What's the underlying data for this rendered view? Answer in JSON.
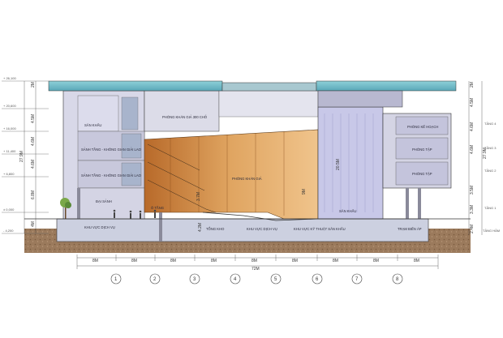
{
  "levels_left": [
    "+ 26,100",
    "+ 20,600",
    "+ 16,000",
    "+ 11,400",
    "+ 6,800",
    "± 0,000",
    "- 4,200"
  ],
  "heights_left": [
    "2M",
    "4.5M",
    "4.6M",
    "4.6M",
    "6.8M",
    "4M"
  ],
  "total_left": "27.9M",
  "heights_right": [
    "2M",
    "4.5M",
    "4.6M",
    "4.6M",
    "3.5M",
    "3.3M",
    "2.4M"
  ],
  "total_right": "27.9M",
  "floors_right": [
    "TẦNG 4",
    "TẦNG 3",
    "TẦNG 2",
    "TẦNG 1",
    "TẦNG HẦM"
  ],
  "rooms": {
    "san_khau_top": "SÂN KHẤU",
    "phong_khan_gia_300": "PHÒNG KHÁN GIẢ 300 CHỖ",
    "sanh_tang3": "SẢNH TẦNG - KHÔNG GIAN GIẢI LAO",
    "sanh_tang2": "SẢNH TẦNG - KHÔNG GIAN GIẢI LAO",
    "dai_sanh": "ĐẠI SẢNH",
    "khu_vuc_dich_vu": "KHU VỰC DỊCH VỤ",
    "o_tang": "Ô TẦNG",
    "phong_khan_gia": "PHÒNG KHÁN GIẢ",
    "tong_kho": "TỔNG KHO",
    "khu_vuc_dich_vu_2": "KHU VỰC DỊCH VỤ",
    "khu_vuc_ky_thuat": "KHU VỰC KỸ THUẬT SÂN KHẤU",
    "san_khau_main": "SÂN KHẤU",
    "tram_bien_ap": "TRẠM BIẾN ÁP",
    "phong_ke_hoach": "PHÒNG KẾ HOẠCH",
    "phong_tap_1": "PHÒNG TẬP",
    "phong_tap_2": "PHÒNG TẬP"
  },
  "inner_dims": {
    "d1": "3.7M",
    "d2": "4.2M",
    "d3": "9M",
    "d4": "20.5M"
  },
  "bay_dims": [
    "8M",
    "8M",
    "8M",
    "8M",
    "8M",
    "8M",
    "8M",
    "8M",
    "8M"
  ],
  "total_width": "72M",
  "grid_labels": [
    "1",
    "2",
    "3",
    "4",
    "5",
    "6",
    "7",
    "8"
  ]
}
